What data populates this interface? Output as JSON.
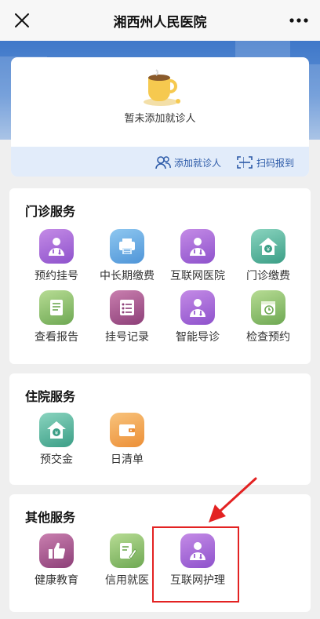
{
  "header": {
    "title": "湘西州人民医院",
    "close_icon": "close-icon",
    "more_icon": "more-icon"
  },
  "patient_card": {
    "empty_text": "暂未添加就诊人",
    "add_patient_label": "添加就诊人",
    "separator": "|",
    "scan_label": "扫码报到"
  },
  "outpatient": {
    "title": "门诊服务",
    "items": [
      {
        "label": "预约挂号",
        "icon": "doctor-icon"
      },
      {
        "label": "中长期缴费",
        "icon": "printer-icon"
      },
      {
        "label": "互联网医院",
        "icon": "doctor-icon"
      },
      {
        "label": "门诊缴费",
        "icon": "yuan-house-icon"
      },
      {
        "label": "查看报告",
        "icon": "report-icon"
      },
      {
        "label": "挂号记录",
        "icon": "list-icon"
      },
      {
        "label": "智能导诊",
        "icon": "doctor-icon"
      },
      {
        "label": "检查预约",
        "icon": "calendar-clock-icon"
      }
    ]
  },
  "inpatient": {
    "title": "住院服务",
    "items": [
      {
        "label": "预交金",
        "icon": "yuan-house-icon"
      },
      {
        "label": "日清单",
        "icon": "wallet-icon"
      }
    ]
  },
  "other": {
    "title": "其他服务",
    "items": [
      {
        "label": "健康教育",
        "icon": "thumbs-up-icon"
      },
      {
        "label": "信用就医",
        "icon": "edit-document-icon"
      },
      {
        "label": "互联网护理",
        "icon": "doctor-icon"
      }
    ]
  },
  "colors": {
    "accent": "#2c5aa8",
    "highlight": "#e32222",
    "banner": "#3f78c9"
  }
}
